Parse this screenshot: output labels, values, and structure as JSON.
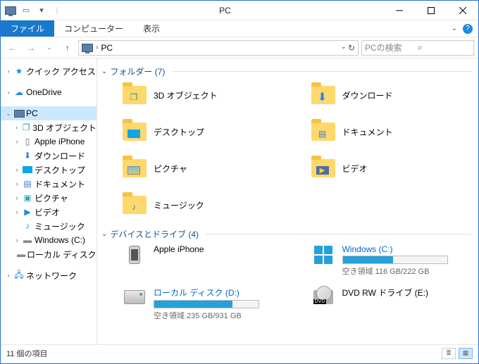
{
  "window": {
    "title": "PC"
  },
  "ribbon": {
    "file": "ファイル",
    "computer": "コンピューター",
    "view": "表示"
  },
  "address": {
    "path": "PC",
    "search_placeholder": "PCの検索"
  },
  "nav": {
    "quick_access": "クイック アクセス",
    "onedrive": "OneDrive",
    "pc": "PC",
    "objects3d": "3D オブジェクト",
    "iphone": "Apple iPhone",
    "downloads": "ダウンロード",
    "desktop": "デスクトップ",
    "documents": "ドキュメント",
    "pictures": "ピクチャ",
    "videos": "ビデオ",
    "music": "ミュージック",
    "windows_c": "Windows (C:)",
    "local_d": "ローカル ディスク (D:)",
    "network": "ネットワーク"
  },
  "groups": {
    "folders_label": "フォルダー (7)",
    "drives_label": "デバイスとドライブ (4)"
  },
  "folders": {
    "objects3d": "3D オブジェクト",
    "downloads": "ダウンロード",
    "desktop": "デスクトップ",
    "documents": "ドキュメント",
    "pictures": "ピクチャ",
    "videos": "ビデオ",
    "music": "ミュージック"
  },
  "drives": {
    "iphone": {
      "name": "Apple iPhone"
    },
    "windows": {
      "name": "Windows (C:)",
      "free": "空き領域 116 GB/222 GB",
      "fill_pct": 48
    },
    "local": {
      "name": "ローカル ディスク (D:)",
      "free": "空き領域 235 GB/931 GB",
      "fill_pct": 75
    },
    "dvd": {
      "name": "DVD RW ドライブ (E:)"
    }
  },
  "status": {
    "count": "11 個の項目"
  }
}
